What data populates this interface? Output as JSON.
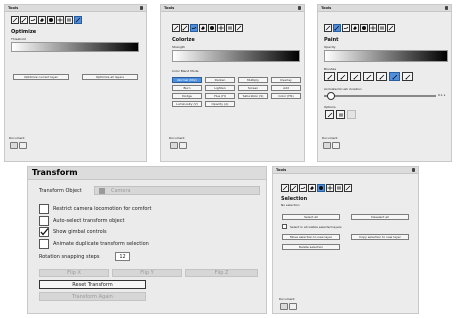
{
  "panels": {
    "optimize": {
      "window_title": "Tools",
      "heading": "Optimize",
      "threshold_label": "Threshold",
      "btn_current": "Optimize current layer",
      "btn_all": "Optimize all layers",
      "document_label": "Document"
    },
    "colorize": {
      "window_title": "Tools",
      "heading": "Colorize",
      "strength_label": "Strength",
      "blend_label": "Color Blend Mode",
      "modes": [
        "Normal (Mix)",
        "Darken",
        "Multiply",
        "Overlay",
        "Burn",
        "Lighten",
        "Screen",
        "Add",
        "Dodge",
        "Hue (H)",
        "Saturation (S)",
        "Color (HS)",
        "Luminosity (V)",
        "Opacity (A)"
      ],
      "document_label": "Document"
    },
    "paint": {
      "window_title": "Tools",
      "heading": "Paint",
      "opacity_label": "Opacity",
      "brushes_label": "Brushes",
      "brush_duration_label": "Animated brush duration",
      "brush_duration_value": "0.1 s",
      "options_label": "Options",
      "document_label": "Document"
    },
    "transform": {
      "window_title": "Transform",
      "object_label": "Transform Object",
      "object_value": "Camera",
      "cb_restrict": "Restrict camera locomotion for comfort",
      "cb_auto": "Auto-select transform object",
      "cb_gimbal": "Show gimbal controls",
      "cb_animate": "Animate duplicate transform selection",
      "rotation_label": "Rotation snapping steps",
      "rotation_value": "12",
      "flip_x": "Flip X",
      "flip_y": "Flip Y",
      "flip_z": "Flip Z",
      "reset": "Reset Transform",
      "again": "Transform Again"
    },
    "selection": {
      "window_title": "Tools",
      "heading": "Selection",
      "subtext": "No selection",
      "select_all": "Select all",
      "deselect_all": "Deselect all",
      "select_visible": "Select in all visible selected layers",
      "move_to_layer": "Move selection to new layer",
      "copy_to_layer": "Copy selection to new layer",
      "delete_sel": "Delete selection",
      "document_label": "Document"
    }
  },
  "colors": {
    "accent": "#4f8fde",
    "panel_bg": "#ececec",
    "titlebar_bg": "#dcdcdc"
  },
  "icons": [
    "line-tool-icon",
    "brush-tool-icon",
    "smudge-tool-icon",
    "eraser-tool-icon",
    "fill-tool-icon",
    "transform-tool-icon",
    "selection-tool-icon",
    "wand-tool-icon"
  ]
}
